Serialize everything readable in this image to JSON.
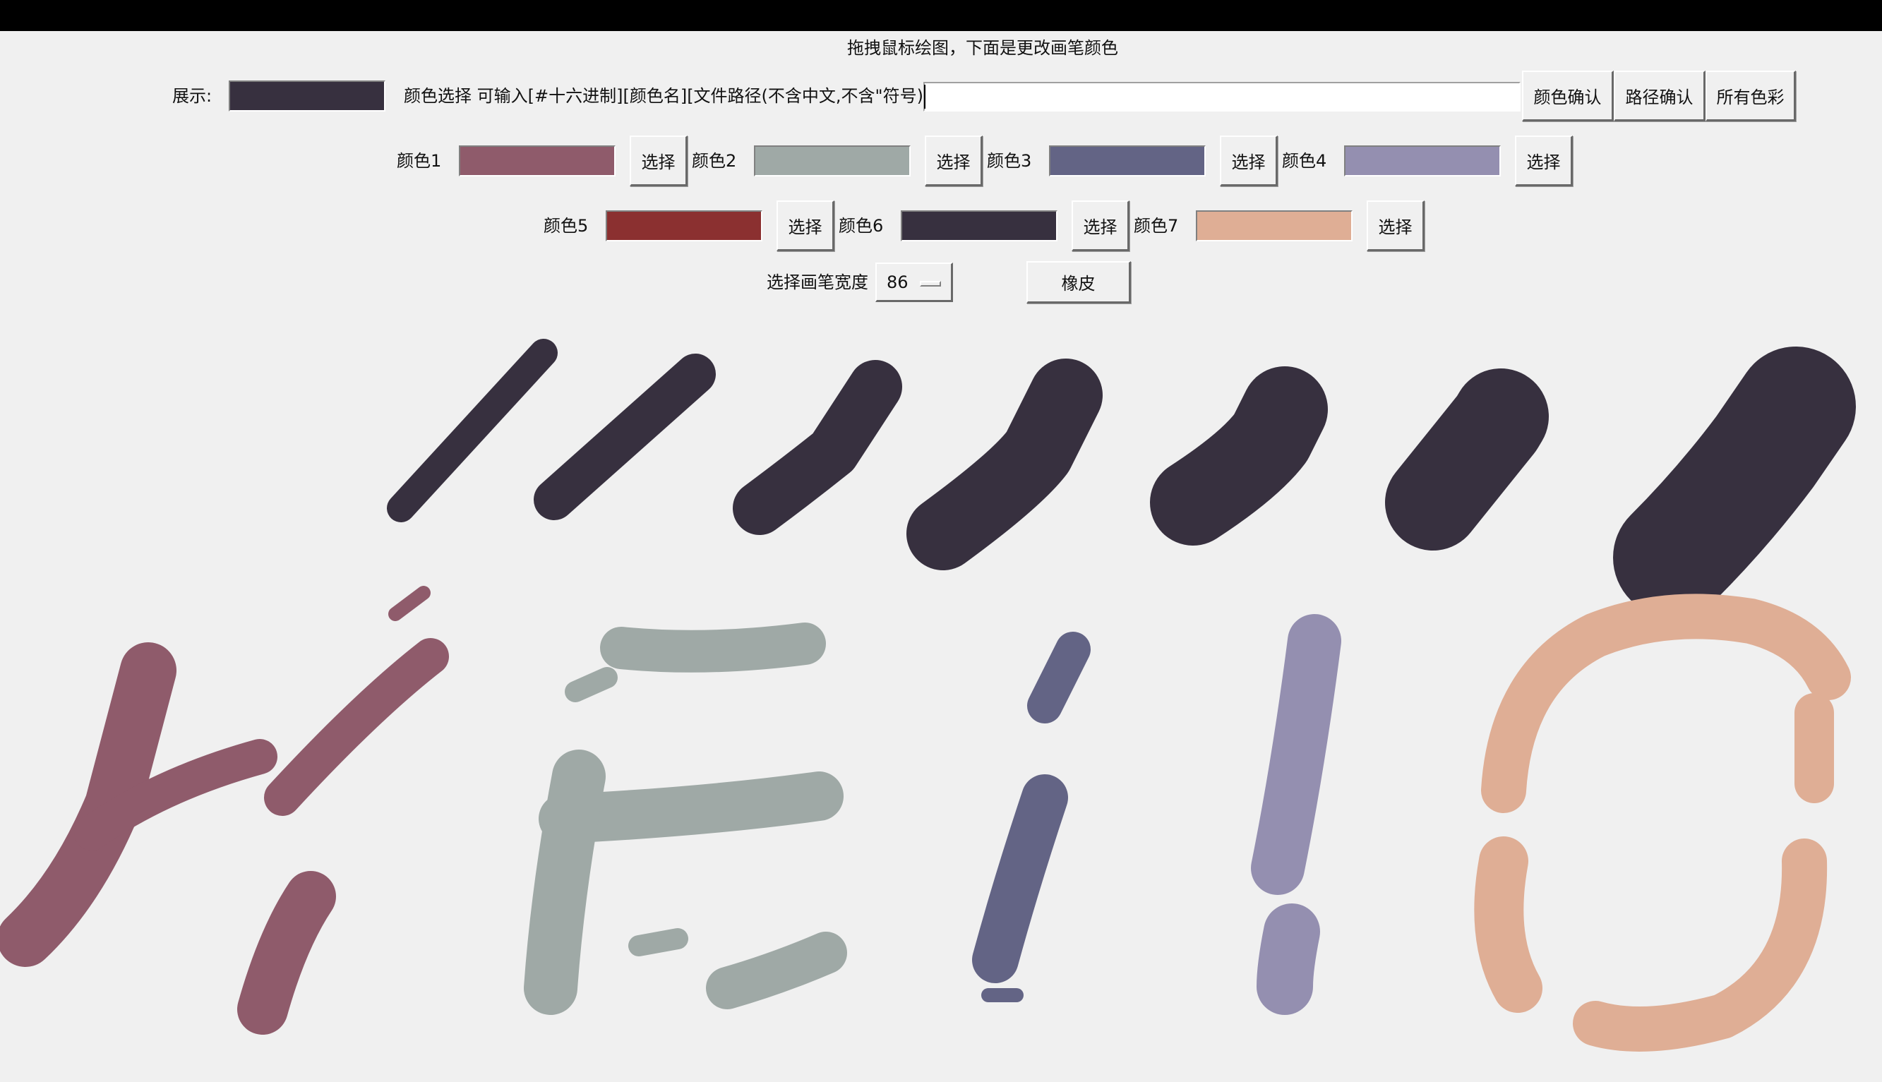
{
  "header": {
    "instruction": "拖拽鼠标绘图，下面是更改画笔颜色"
  },
  "display": {
    "label": "展示:",
    "color": "#37303f"
  },
  "color_input": {
    "label": "颜色选择 可输入[#十六进制][颜色名][文件路径(不含中文,不含\"符号)]",
    "value": "",
    "buttons": {
      "confirm_color": "颜色确认",
      "confirm_path": "路径确认",
      "all_colors": "所有色彩"
    }
  },
  "palette": {
    "select_label": "选择",
    "colors": [
      {
        "label": "颜色1",
        "hex": "#8f5b6b"
      },
      {
        "label": "颜色2",
        "hex": "#9fa9a6"
      },
      {
        "label": "颜色3",
        "hex": "#636485"
      },
      {
        "label": "颜色4",
        "hex": "#948fb0"
      },
      {
        "label": "颜色5",
        "hex": "#8b3030"
      },
      {
        "label": "颜色6",
        "hex": "#37303f"
      },
      {
        "label": "颜色7",
        "hex": "#dfae95"
      }
    ]
  },
  "brush": {
    "label": "选择画笔宽度",
    "width": "86",
    "eraser_label": "橡皮"
  },
  "canvas": {
    "background": "#f0f0f0",
    "strokes": [
      {
        "name": "stroke-row-1",
        "color": "#37303f"
      },
      {
        "name": "stroke-row-2",
        "color": "#37303f"
      },
      {
        "name": "stroke-row-3",
        "color": "#37303f"
      },
      {
        "name": "stroke-row-4",
        "color": "#37303f"
      },
      {
        "name": "stroke-row-5",
        "color": "#37303f"
      },
      {
        "name": "stroke-row-6",
        "color": "#37303f"
      },
      {
        "name": "stroke-row-7",
        "color": "#37303f"
      },
      {
        "name": "letter-h",
        "color": "#8f5b6b"
      },
      {
        "name": "letter-e",
        "color": "#9fa9a6"
      },
      {
        "name": "letter-l1",
        "color": "#636485"
      },
      {
        "name": "letter-l2",
        "color": "#948fb0"
      },
      {
        "name": "letter-o",
        "color": "#dfae95"
      }
    ]
  }
}
